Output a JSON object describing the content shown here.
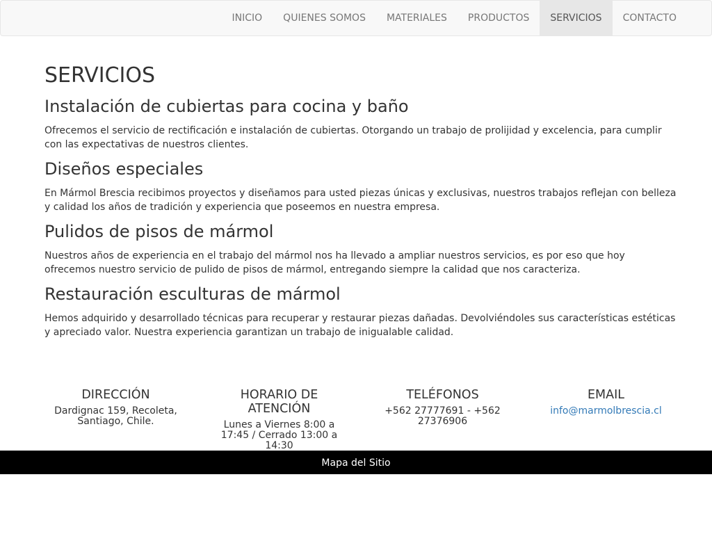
{
  "nav": {
    "items": [
      {
        "label": "INICIO"
      },
      {
        "label": "QUIENES SOMOS"
      },
      {
        "label": "MATERIALES"
      },
      {
        "label": "PRODUCTOS"
      },
      {
        "label": "SERVICIOS",
        "active": true
      },
      {
        "label": "CONTACTO"
      }
    ]
  },
  "page": {
    "title": "SERVICIOS",
    "sections": [
      {
        "heading": "Instalación de cubiertas para cocina y baño",
        "text": "Ofrecemos el servicio de rectificación e instalación de cubiertas. Otorgando un trabajo de prolijidad y excelencia, para cumplir con las expectativas de nuestros clientes."
      },
      {
        "heading": "Diseños especiales",
        "text": "En Mármol Brescia recibimos proyectos y diseñamos para usted piezas únicas y exclusivas, nuestros trabajos reflejan con belleza y calidad los años de tradición y experiencia que poseemos en nuestra empresa."
      },
      {
        "heading": "Pulidos de pisos de mármol",
        "text": "Nuestros años de experiencia en el trabajo del mármol nos ha llevado a ampliar nuestros servicios, es por eso que hoy ofrecemos nuestro servicio de pulido de pisos de mármol, entregando siempre la calidad que nos caracteriza."
      },
      {
        "heading": "Restauración esculturas de mármol",
        "text": "Hemos adquirido y desarrollado técnicas para recuperar y restaurar piezas dañadas. Devolviéndoles sus características estéticas y apreciado valor. Nuestra experiencia garantizan un trabajo de inigualable calidad."
      }
    ]
  },
  "footer": {
    "address_title": "DIRECCIÓN",
    "address_text": "Dardignac 159, Recoleta, Santiago, Chile.",
    "hours_title": "HORARIO DE ATENCIÓN",
    "hours_text": "Lunes a Viernes 8:00 a 17:45 / Cerrado 13:00 a 14:30",
    "phones_title": "TELÉFONOS",
    "phones_text": "+562 27777691 - +562 27376906",
    "email_title": "EMAIL",
    "email_text": "info@marmolbrescia.cl",
    "sitemap_label": "Mapa del Sitio"
  },
  "colors": {
    "link": "#337ab7",
    "navbar_bg": "#f8f8f8",
    "nav_active_bg": "#e7e7e7",
    "footer_bar_bg": "#000000"
  }
}
